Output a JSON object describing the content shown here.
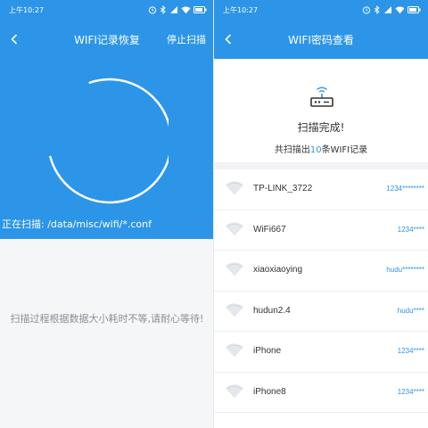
{
  "status_bar": {
    "time": "上午10:27",
    "icons": [
      "alarm-icon",
      "bluetooth-icon",
      "signal-icon",
      "wifi-icon",
      "battery-icon"
    ]
  },
  "left_screen": {
    "title": "WIFI记录恢复",
    "action": "停止扫描",
    "scan_path": "正在扫描: /data/misc/wifi/*.conf",
    "hint": "扫描过程根据数据大小耗时不等,请耐心等待!"
  },
  "right_screen": {
    "title": "WIFI密码查看",
    "done_text": "扫描完成!",
    "count_prefix": "共扫描出",
    "count_value": "10",
    "count_suffix": "条WIFI记录",
    "networks": [
      {
        "ssid": "TP-LINK_3722",
        "password": "1234********"
      },
      {
        "ssid": "WiFi667",
        "password": "1234****"
      },
      {
        "ssid": "xiaoxiaoying",
        "password": "hudu********"
      },
      {
        "ssid": "hudun2.4",
        "password": "hudu****"
      },
      {
        "ssid": "iPhone",
        "password": "1234****"
      },
      {
        "ssid": "iPhone8",
        "password": "1234****"
      }
    ]
  },
  "colors": {
    "accent": "#2c95e8",
    "background": "#f5f6f8",
    "text": "#333333",
    "hint": "#8b9096"
  }
}
